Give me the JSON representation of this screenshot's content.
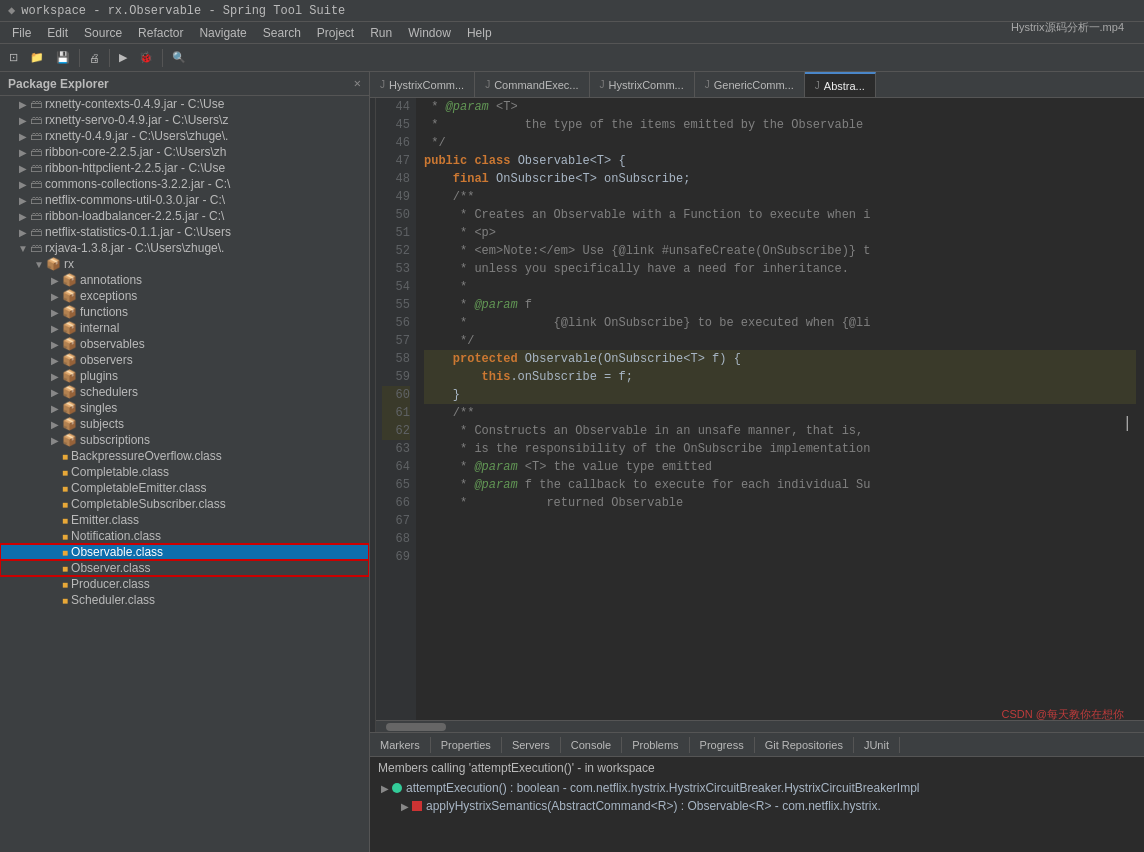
{
  "titleBar": {
    "title": "workspace - rx.Observable - Spring Tool Suite",
    "icon": "◆"
  },
  "menuBar": {
    "items": [
      "File",
      "Edit",
      "Source",
      "Refactor",
      "Navigate",
      "Search",
      "Project",
      "Run",
      "Window",
      "Help"
    ]
  },
  "sidebar": {
    "title": "Package Explorer",
    "items": [
      {
        "id": "rxnetty-contexts",
        "label": "rxnetty-contexts-0.4.9.jar - C:\\Use",
        "level": 2,
        "icon": "jar",
        "expanded": false
      },
      {
        "id": "rxnetty-servo",
        "label": "rxnetty-servo-0.4.9.jar - C:\\Users\\z",
        "level": 2,
        "icon": "jar",
        "expanded": false
      },
      {
        "id": "rxnetty",
        "label": "rxnetty-0.4.9.jar - C:\\Users\\zhuge\\.",
        "level": 2,
        "icon": "jar",
        "expanded": false
      },
      {
        "id": "ribbon-core",
        "label": "ribbon-core-2.2.5.jar - C:\\Users\\zh",
        "level": 2,
        "icon": "jar",
        "expanded": false
      },
      {
        "id": "ribbon-http",
        "label": "ribbon-httpclient-2.2.5.jar - C:\\Use",
        "level": 2,
        "icon": "jar",
        "expanded": false
      },
      {
        "id": "commons",
        "label": "commons-collections-3.2.2.jar - C:\\",
        "level": 2,
        "icon": "jar",
        "expanded": false
      },
      {
        "id": "netflix-commons",
        "label": "netflix-commons-util-0.3.0.jar - C:\\",
        "level": 2,
        "icon": "jar",
        "expanded": false
      },
      {
        "id": "ribbon-lb",
        "label": "ribbon-loadbalancer-2.2.5.jar - C:\\",
        "level": 2,
        "icon": "jar",
        "expanded": false
      },
      {
        "id": "netflix-stats",
        "label": "netflix-statistics-0.1.1.jar - C:\\Users",
        "level": 2,
        "icon": "jar",
        "expanded": false
      },
      {
        "id": "rxjava",
        "label": "rxjava-1.3.8.jar - C:\\Users\\zhuge\\.",
        "level": 2,
        "icon": "jar",
        "expanded": true
      },
      {
        "id": "rx",
        "label": "rx",
        "level": 3,
        "icon": "package",
        "expanded": true
      },
      {
        "id": "annotations",
        "label": "annotations",
        "level": 4,
        "icon": "package",
        "expanded": false
      },
      {
        "id": "exceptions",
        "label": "exceptions",
        "level": 4,
        "icon": "package",
        "expanded": false
      },
      {
        "id": "functions",
        "label": "functions",
        "level": 4,
        "icon": "package",
        "expanded": false
      },
      {
        "id": "internal",
        "label": "internal",
        "level": 4,
        "icon": "package",
        "expanded": false
      },
      {
        "id": "observables",
        "label": "observables",
        "level": 4,
        "icon": "package",
        "expanded": false
      },
      {
        "id": "observers",
        "label": "observers",
        "level": 4,
        "icon": "package",
        "expanded": false
      },
      {
        "id": "plugins",
        "label": "plugins",
        "level": 4,
        "icon": "package",
        "expanded": false
      },
      {
        "id": "schedulers",
        "label": "schedulers",
        "level": 4,
        "icon": "package",
        "expanded": false
      },
      {
        "id": "singles",
        "label": "singles",
        "level": 4,
        "icon": "package",
        "expanded": false
      },
      {
        "id": "subjects",
        "label": "subjects",
        "level": 4,
        "icon": "package",
        "expanded": false
      },
      {
        "id": "subscriptions",
        "label": "subscriptions",
        "level": 4,
        "icon": "package",
        "expanded": false
      },
      {
        "id": "BackpressureOverflow",
        "label": "BackpressureOverflow.class",
        "level": 4,
        "icon": "class",
        "expanded": false
      },
      {
        "id": "Completable",
        "label": "Completable.class",
        "level": 4,
        "icon": "class",
        "expanded": false
      },
      {
        "id": "CompletableEmitter",
        "label": "CompletableEmitter.class",
        "level": 4,
        "icon": "class",
        "expanded": false
      },
      {
        "id": "CompletableSubscriber",
        "label": "CompletableSubscriber.class",
        "level": 4,
        "icon": "class",
        "expanded": false
      },
      {
        "id": "Emitter",
        "label": "Emitter.class",
        "level": 4,
        "icon": "class",
        "expanded": false
      },
      {
        "id": "Notification",
        "label": "Notification.class",
        "level": 4,
        "icon": "class",
        "expanded": false
      },
      {
        "id": "Observable",
        "label": "Observable.class",
        "level": 4,
        "icon": "class",
        "expanded": false,
        "selected": true
      },
      {
        "id": "Observer",
        "label": "Observer.class",
        "level": 4,
        "icon": "class",
        "expanded": false
      },
      {
        "id": "Producer",
        "label": "Producer.class",
        "level": 4,
        "icon": "class",
        "expanded": false
      },
      {
        "id": "Scheduler",
        "label": "Scheduler.class",
        "level": 4,
        "icon": "class",
        "expanded": false
      }
    ]
  },
  "editorTabs": [
    {
      "id": "HystrixComm1",
      "label": "HystrixComm...",
      "active": false,
      "icon": "J"
    },
    {
      "id": "CommandExec",
      "label": "CommandExec...",
      "active": false,
      "icon": "J"
    },
    {
      "id": "HystrixComm2",
      "label": "HystrixComm...",
      "active": false,
      "icon": "J"
    },
    {
      "id": "GenericComm",
      "label": "GenericComm...",
      "active": false,
      "icon": "J"
    },
    {
      "id": "Abstract",
      "label": "Abstra...",
      "active": false,
      "icon": "J"
    }
  ],
  "codeLines": [
    {
      "num": 44,
      "text": " * @param <T>",
      "highlight": false
    },
    {
      "num": 45,
      "text": " *            the type of the items emitted by the Observable",
      "highlight": false
    },
    {
      "num": 46,
      "text": " */",
      "highlight": false
    },
    {
      "num": 47,
      "text": "public class Observable<T> {",
      "highlight": false
    },
    {
      "num": 48,
      "text": "",
      "highlight": false
    },
    {
      "num": 49,
      "text": "    final OnSubscribe<T> onSubscribe;",
      "highlight": false
    },
    {
      "num": 50,
      "text": "",
      "highlight": false
    },
    {
      "num": 51,
      "text": "    /**",
      "highlight": false
    },
    {
      "num": 52,
      "text": "     * Creates an Observable with a Function to execute when i",
      "highlight": false
    },
    {
      "num": 53,
      "text": "     * <p>",
      "highlight": false
    },
    {
      "num": 54,
      "text": "     * <em>Note:</em> Use {@link #unsafeCreate(OnSubscribe)} t",
      "highlight": false
    },
    {
      "num": 55,
      "text": "     * unless you specifically have a need for inheritance.",
      "highlight": false
    },
    {
      "num": 56,
      "text": "     *",
      "highlight": false
    },
    {
      "num": 57,
      "text": "     * @param f",
      "highlight": false
    },
    {
      "num": 58,
      "text": "     *            {@link OnSubscribe} to be executed when {@li",
      "highlight": false
    },
    {
      "num": 59,
      "text": "     */",
      "highlight": false
    },
    {
      "num": 60,
      "text": "    protected Observable(OnSubscribe<T> f) {",
      "highlight": true
    },
    {
      "num": 61,
      "text": "        this.onSubscribe = f;",
      "highlight": true
    },
    {
      "num": 62,
      "text": "    }",
      "highlight": true
    },
    {
      "num": 63,
      "text": "",
      "highlight": false
    },
    {
      "num": 64,
      "text": "    /**",
      "highlight": false
    },
    {
      "num": 65,
      "text": "     * Constructs an Observable in an unsafe manner, that is,",
      "highlight": false
    },
    {
      "num": 66,
      "text": "     * is the responsibility of the OnSubscribe implementation",
      "highlight": false
    },
    {
      "num": 67,
      "text": "     * @param <T> the value type emitted",
      "highlight": false
    },
    {
      "num": 68,
      "text": "     * @param f the callback to execute for each individual Su",
      "highlight": false
    },
    {
      "num": 69,
      "text": "     *           returned Observable",
      "highlight": false
    }
  ],
  "bottomTabs": [
    {
      "id": "markers",
      "label": "Markers",
      "active": false
    },
    {
      "id": "properties",
      "label": "Properties",
      "active": false
    },
    {
      "id": "servers",
      "label": "Servers",
      "active": false
    },
    {
      "id": "console",
      "label": "Console",
      "active": false
    },
    {
      "id": "problems",
      "label": "Problems",
      "active": false
    },
    {
      "id": "progress",
      "label": "Progress",
      "active": false
    },
    {
      "id": "gitrepos",
      "label": "Git Repositories",
      "active": false
    },
    {
      "id": "junit",
      "label": "JUnit",
      "active": false
    }
  ],
  "bottomContent": {
    "header": "Members calling 'attemptExecution()' - in workspace",
    "items": [
      {
        "id": "attemptExecution",
        "label": "attemptExecution() : boolean - com.netflix.hystrix.HystrixCircuitBreaker.HystrixCircuitBreakerImpl",
        "icon": "green",
        "sub": false
      },
      {
        "id": "applyHystrix",
        "label": "applyHystrixSemantics(AbstractCommand<R>) : Observable<R> - com.netflix.hystrix.",
        "icon": "red",
        "sub": true
      }
    ]
  },
  "watermark": {
    "csdn": "CSDN @每天教你在想你",
    "topRight": "Hystrix源码分析一.mp4"
  }
}
